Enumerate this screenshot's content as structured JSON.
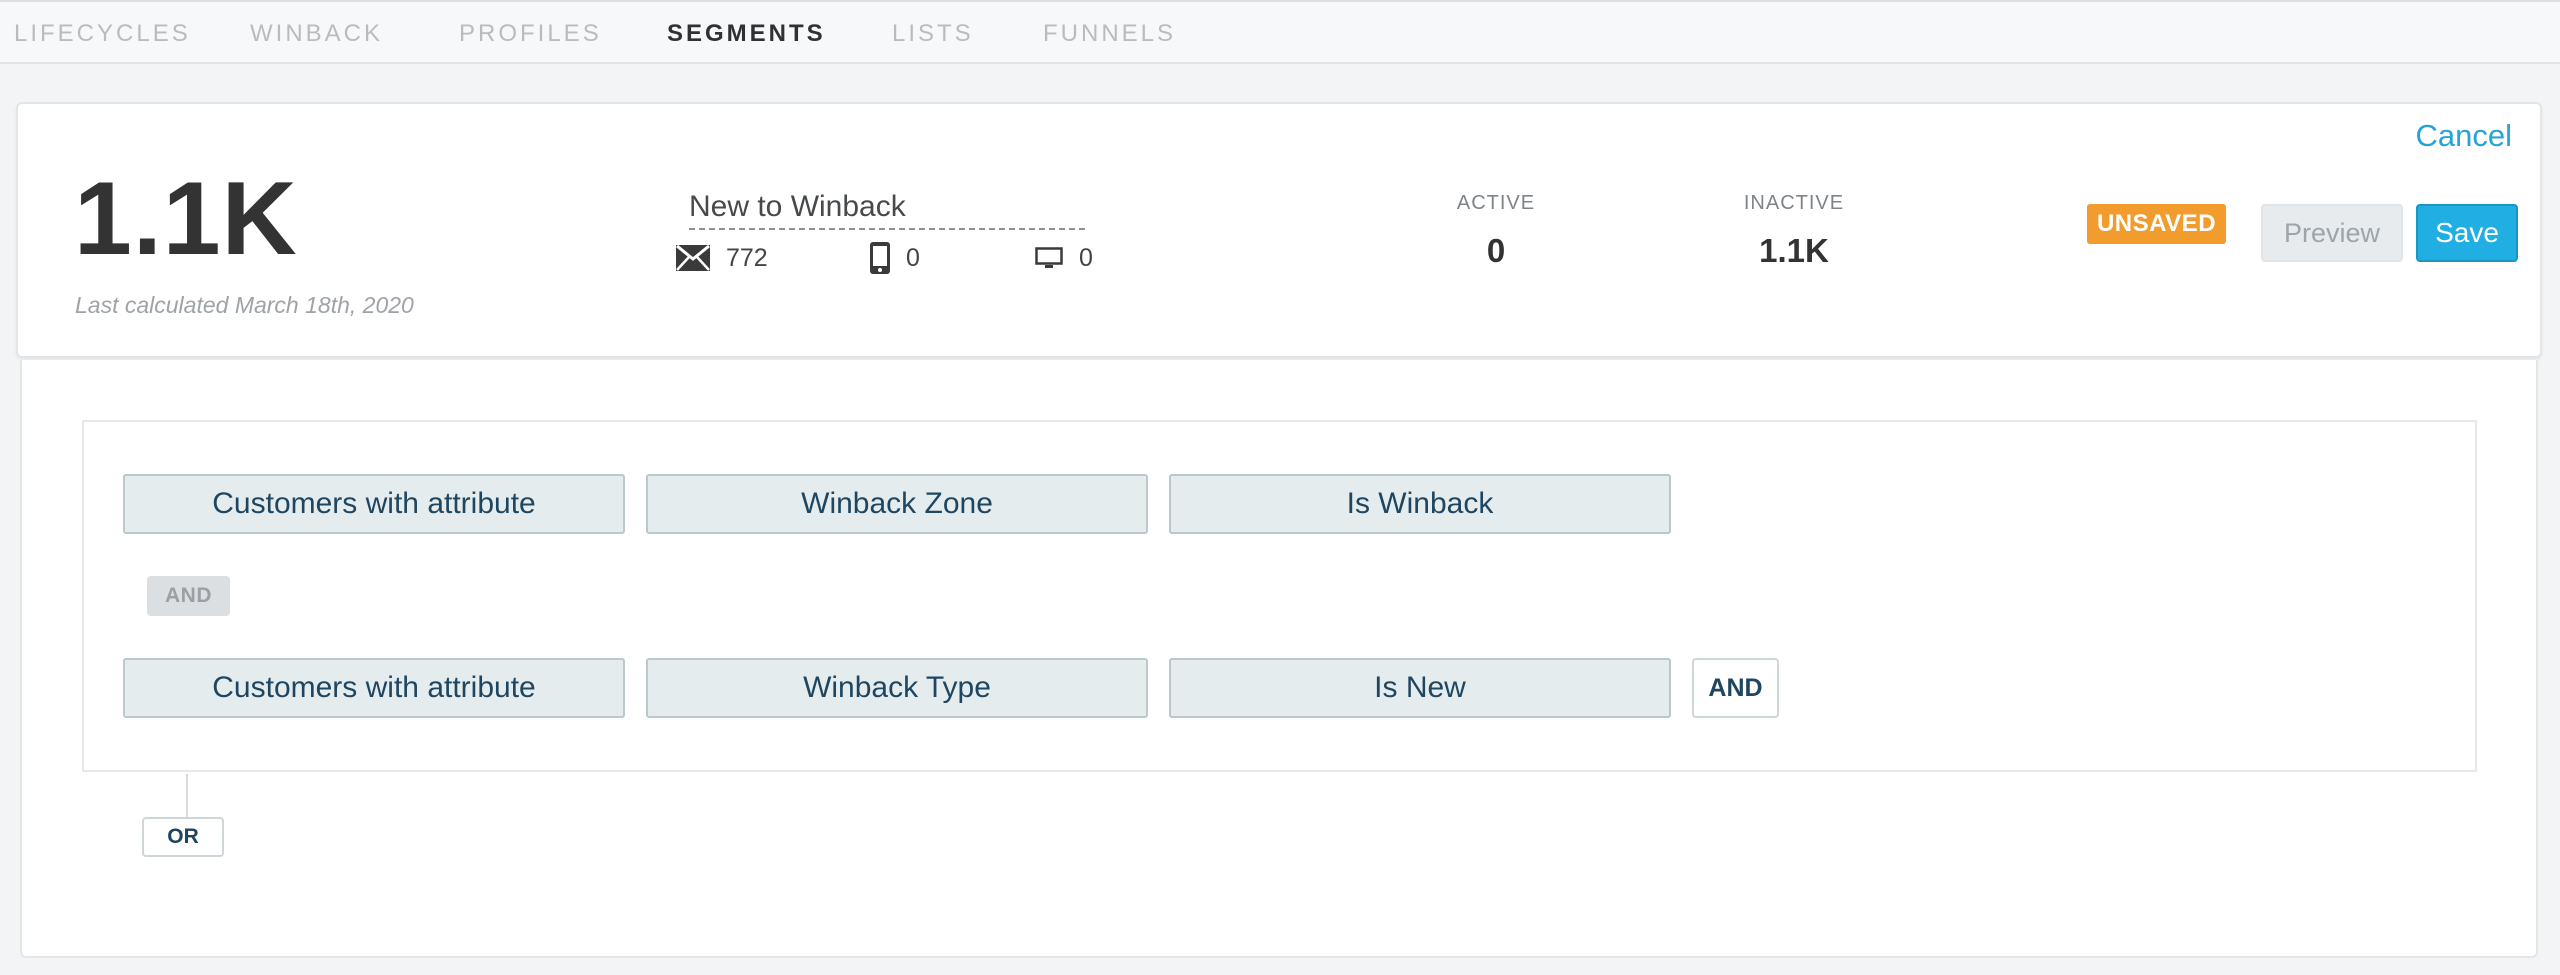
{
  "nav": {
    "tabs": [
      {
        "label": "LIFECYCLES"
      },
      {
        "label": "WINBACK"
      },
      {
        "label": "PROFILES"
      },
      {
        "label": "SEGMENTS"
      },
      {
        "label": "LISTS"
      },
      {
        "label": "FUNNELS"
      }
    ],
    "active_tab": "SEGMENTS"
  },
  "summary": {
    "count": "1.1K",
    "last_calculated": "Last calculated March 18th, 2020",
    "segment_name": "New to Winback",
    "channels": [
      {
        "icon": "envelope-icon",
        "value": "772"
      },
      {
        "icon": "phone-icon",
        "value": "0"
      },
      {
        "icon": "desktop-icon",
        "value": "0"
      }
    ],
    "active_label": "ACTIVE",
    "active_value": "0",
    "inactive_label": "INACTIVE",
    "inactive_value": "1.1K"
  },
  "actions": {
    "cancel": "Cancel",
    "status_badge": "UNSAVED",
    "preview": "Preview",
    "save": "Save"
  },
  "rules": {
    "groups": [
      {
        "subject": "Customers with attribute",
        "attribute": "Winback Zone",
        "condition": "Is Winback"
      },
      {
        "subject": "Customers with attribute",
        "attribute": "Winback Type",
        "condition": "Is New"
      }
    ],
    "and_separator": "AND",
    "add_and": "AND",
    "add_or": "OR"
  },
  "colors": {
    "accent": "#20aee3",
    "unsaved_badge": "#f39c2e",
    "rule_text": "#1f4660"
  }
}
